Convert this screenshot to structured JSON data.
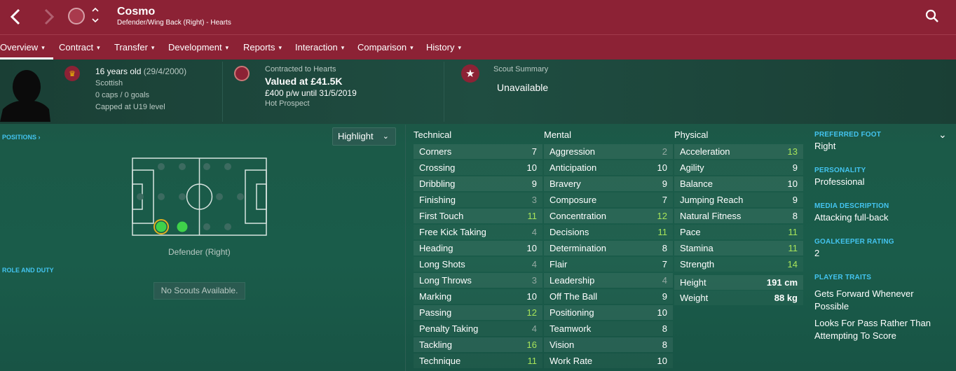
{
  "player": {
    "name": "Cosmo",
    "subtitle": "Defender/Wing Back (Right) - Hearts"
  },
  "nav": {
    "tabs": [
      "Overview",
      "Contract",
      "Transfer",
      "Development",
      "Reports",
      "Interaction",
      "Comparison",
      "History"
    ]
  },
  "info": {
    "age": "16 years old",
    "dob": "(29/4/2000)",
    "nationality": "Scottish",
    "caps": "0 caps / 0 goals",
    "capped": "Capped at U19 level",
    "contract_caption": "Contracted to Hearts",
    "value": "Valued at £41.5K",
    "wage": "£400 p/w until 31/5/2019",
    "prospect": "Hot Prospect",
    "scout_caption": "Scout Summary",
    "scout_value": "Unavailable"
  },
  "left": {
    "positions": "POSITIONS",
    "highlight": "Highlight",
    "position_label": "Defender (Right)",
    "role": "ROLE AND DUTY",
    "no_scouts": "No Scouts Available."
  },
  "attributes": {
    "technical_title": "Technical",
    "technical": [
      {
        "n": "Corners",
        "v": "7"
      },
      {
        "n": "Crossing",
        "v": "10"
      },
      {
        "n": "Dribbling",
        "v": "9"
      },
      {
        "n": "Finishing",
        "v": "3"
      },
      {
        "n": "First Touch",
        "v": "11"
      },
      {
        "n": "Free Kick Taking",
        "v": "4"
      },
      {
        "n": "Heading",
        "v": "10"
      },
      {
        "n": "Long Shots",
        "v": "4"
      },
      {
        "n": "Long Throws",
        "v": "3"
      },
      {
        "n": "Marking",
        "v": "10"
      },
      {
        "n": "Passing",
        "v": "12"
      },
      {
        "n": "Penalty Taking",
        "v": "4"
      },
      {
        "n": "Tackling",
        "v": "16"
      },
      {
        "n": "Technique",
        "v": "11"
      }
    ],
    "mental_title": "Mental",
    "mental": [
      {
        "n": "Aggression",
        "v": "2"
      },
      {
        "n": "Anticipation",
        "v": "10"
      },
      {
        "n": "Bravery",
        "v": "9"
      },
      {
        "n": "Composure",
        "v": "7"
      },
      {
        "n": "Concentration",
        "v": "12"
      },
      {
        "n": "Decisions",
        "v": "11"
      },
      {
        "n": "Determination",
        "v": "8"
      },
      {
        "n": "Flair",
        "v": "7"
      },
      {
        "n": "Leadership",
        "v": "4"
      },
      {
        "n": "Off The Ball",
        "v": "9"
      },
      {
        "n": "Positioning",
        "v": "10"
      },
      {
        "n": "Teamwork",
        "v": "8"
      },
      {
        "n": "Vision",
        "v": "8"
      },
      {
        "n": "Work Rate",
        "v": "10"
      }
    ],
    "physical_title": "Physical",
    "physical": [
      {
        "n": "Acceleration",
        "v": "13"
      },
      {
        "n": "Agility",
        "v": "9"
      },
      {
        "n": "Balance",
        "v": "10"
      },
      {
        "n": "Jumping Reach",
        "v": "9"
      },
      {
        "n": "Natural Fitness",
        "v": "8"
      },
      {
        "n": "Pace",
        "v": "11"
      },
      {
        "n": "Stamina",
        "v": "11"
      },
      {
        "n": "Strength",
        "v": "14"
      }
    ],
    "height_label": "Height",
    "height": "191 cm",
    "weight_label": "Weight",
    "weight": "88 kg"
  },
  "right": {
    "foot_caption": "PREFERRED FOOT",
    "foot": "Right",
    "personality_caption": "PERSONALITY",
    "personality": "Professional",
    "media_caption": "MEDIA DESCRIPTION",
    "media": "Attacking full-back",
    "gk_caption": "GOALKEEPER RATING",
    "gk": "2",
    "traits_caption": "PLAYER TRAITS",
    "trait1": "Gets Forward Whenever Possible",
    "trait2": "Looks For Pass Rather Than Attempting To Score"
  }
}
